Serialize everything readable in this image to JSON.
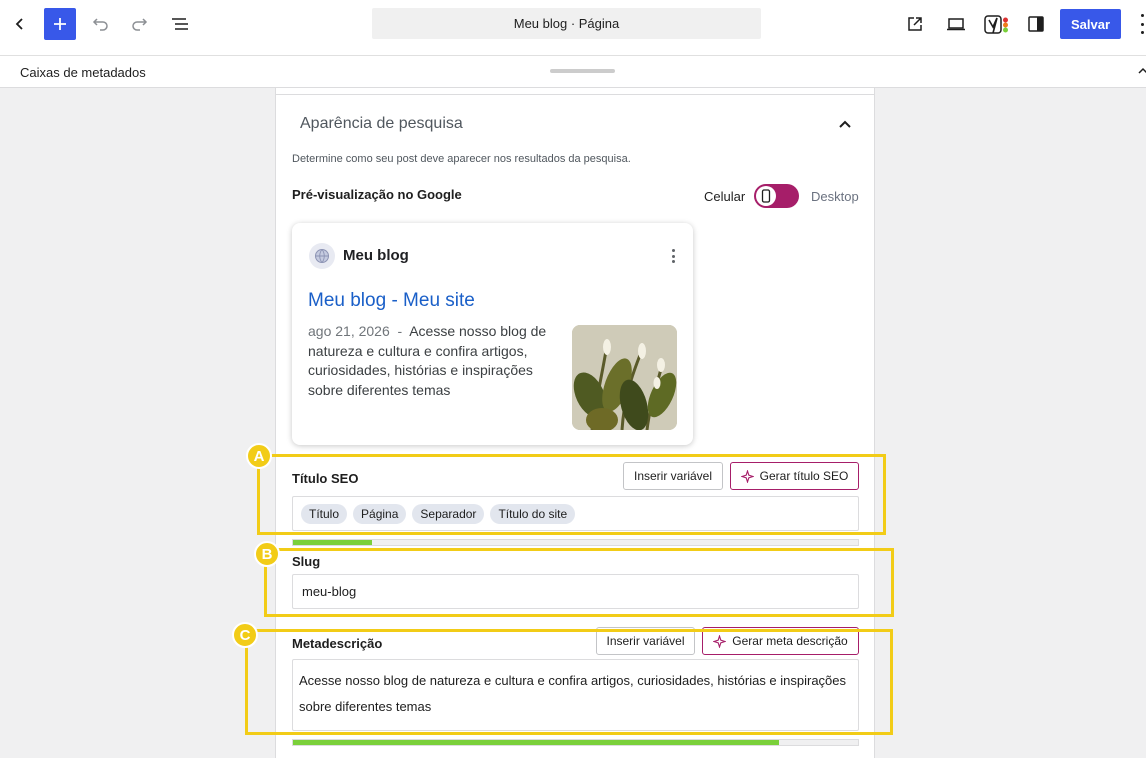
{
  "toolbar": {
    "document_title": "Meu blog · Página",
    "save_label": "Salvar",
    "brand_color": "#3858e9"
  },
  "metabox_bar": {
    "label": "Caixas de metadados"
  },
  "search_appearance": {
    "title": "Aparência de pesquisa",
    "description": "Determine como seu post deve aparecer nos resultados da pesquisa.",
    "preview_label": "Pré-visualização no Google",
    "mode_mobile": "Celular",
    "mode_desktop": "Desktop",
    "mode_selected": "Celular",
    "toggle_color": "#a61e69"
  },
  "google_preview": {
    "site_name": "Meu blog",
    "title": "Meu blog - Meu site",
    "date": "ago 21, 2026",
    "separator": "-",
    "description": "Acesse nosso blog de natureza e cultura e confira artigos, curiosidades, histórias e inspirações sobre diferentes temas"
  },
  "seo_title": {
    "label": "Título SEO",
    "insert_variable": "Inserir variável",
    "generate": "Gerar título SEO",
    "chips": [
      "Título",
      "Página",
      "Separador",
      "Título do site"
    ],
    "progress": 0.14
  },
  "slug": {
    "label": "Slug",
    "value": "meu-blog"
  },
  "meta_description": {
    "label": "Metadescrição",
    "insert_variable": "Inserir variável",
    "generate": "Gerar meta descrição",
    "value": "Acesse nosso blog de natureza e cultura e confira artigos, curiosidades, histórias e inspirações sobre diferentes temas",
    "progress": 0.86
  },
  "annotations": {
    "a": "A",
    "b": "B",
    "c": "C",
    "color": "#f2cc17"
  },
  "icons": [
    "back-arrow-icon",
    "plus-icon",
    "undo-icon",
    "redo-icon",
    "list-view-icon",
    "external-link-icon",
    "laptop-icon",
    "yoast-icon",
    "sidebar-icon",
    "more-vertical-icon",
    "chevron-up-icon",
    "globe-icon",
    "sparkle-icon"
  ]
}
